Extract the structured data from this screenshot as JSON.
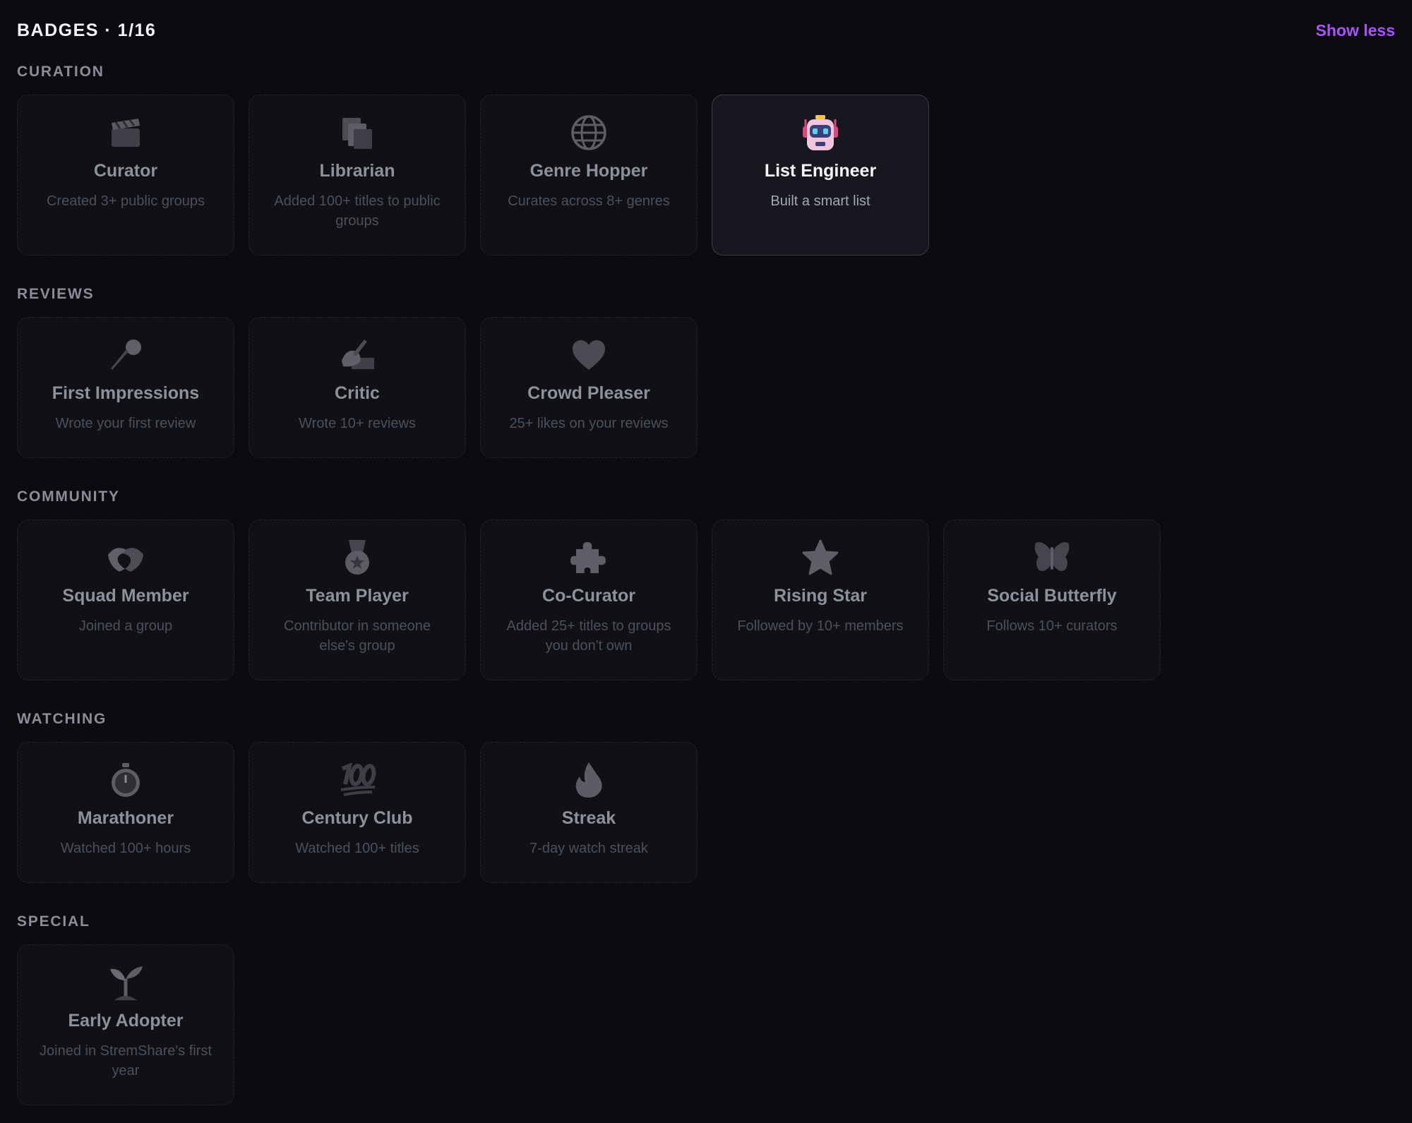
{
  "header": {
    "title": "BADGES · 1/16",
    "toggle_label": "Show less"
  },
  "colors": {
    "accent": "#a855f7",
    "background": "#0b0b10",
    "card_locked": "#101116",
    "card_earned": "#17181f"
  },
  "sections": [
    {
      "title": "CURATION",
      "badges": [
        {
          "name": "Curator",
          "desc": "Created 3+ public groups",
          "icon": "clapperboard-icon",
          "earned": false
        },
        {
          "name": "Librarian",
          "desc": "Added 100+ titles to public groups",
          "icon": "stacked-pages-icon",
          "earned": false
        },
        {
          "name": "Genre Hopper",
          "desc": "Curates across 8+ genres",
          "icon": "globe-icon",
          "earned": false
        },
        {
          "name": "List Engineer",
          "desc": "Built a smart list",
          "icon": "robot-icon",
          "earned": true
        }
      ]
    },
    {
      "title": "REVIEWS",
      "badges": [
        {
          "name": "First Impressions",
          "desc": "Wrote your first review",
          "icon": "microphone-icon",
          "earned": false
        },
        {
          "name": "Critic",
          "desc": "Wrote 10+ reviews",
          "icon": "writing-hand-icon",
          "earned": false
        },
        {
          "name": "Crowd Pleaser",
          "desc": "25+ likes on your reviews",
          "icon": "heart-icon",
          "earned": false
        }
      ]
    },
    {
      "title": "COMMUNITY",
      "badges": [
        {
          "name": "Squad Member",
          "desc": "Joined a group",
          "icon": "handshake-icon",
          "earned": false
        },
        {
          "name": "Team Player",
          "desc": "Contributor in someone else's group",
          "icon": "medal-icon",
          "earned": false
        },
        {
          "name": "Co-Curator",
          "desc": "Added 25+ titles to groups you don't own",
          "icon": "puzzle-piece-icon",
          "earned": false
        },
        {
          "name": "Rising Star",
          "desc": "Followed by 10+ members",
          "icon": "star-icon",
          "earned": false
        },
        {
          "name": "Social Butterfly",
          "desc": "Follows 10+ curators",
          "icon": "butterfly-icon",
          "earned": false
        }
      ]
    },
    {
      "title": "WATCHING",
      "badges": [
        {
          "name": "Marathoner",
          "desc": "Watched 100+ hours",
          "icon": "stopwatch-icon",
          "earned": false
        },
        {
          "name": "Century Club",
          "desc": "Watched 100+ titles",
          "icon": "hundred-points-icon",
          "earned": false
        },
        {
          "name": "Streak",
          "desc": "7-day watch streak",
          "icon": "flame-icon",
          "earned": false
        }
      ]
    },
    {
      "title": "SPECIAL",
      "badges": [
        {
          "name": "Early Adopter",
          "desc": "Joined in StremShare's first year",
          "icon": "seedling-icon",
          "earned": false
        }
      ]
    }
  ]
}
